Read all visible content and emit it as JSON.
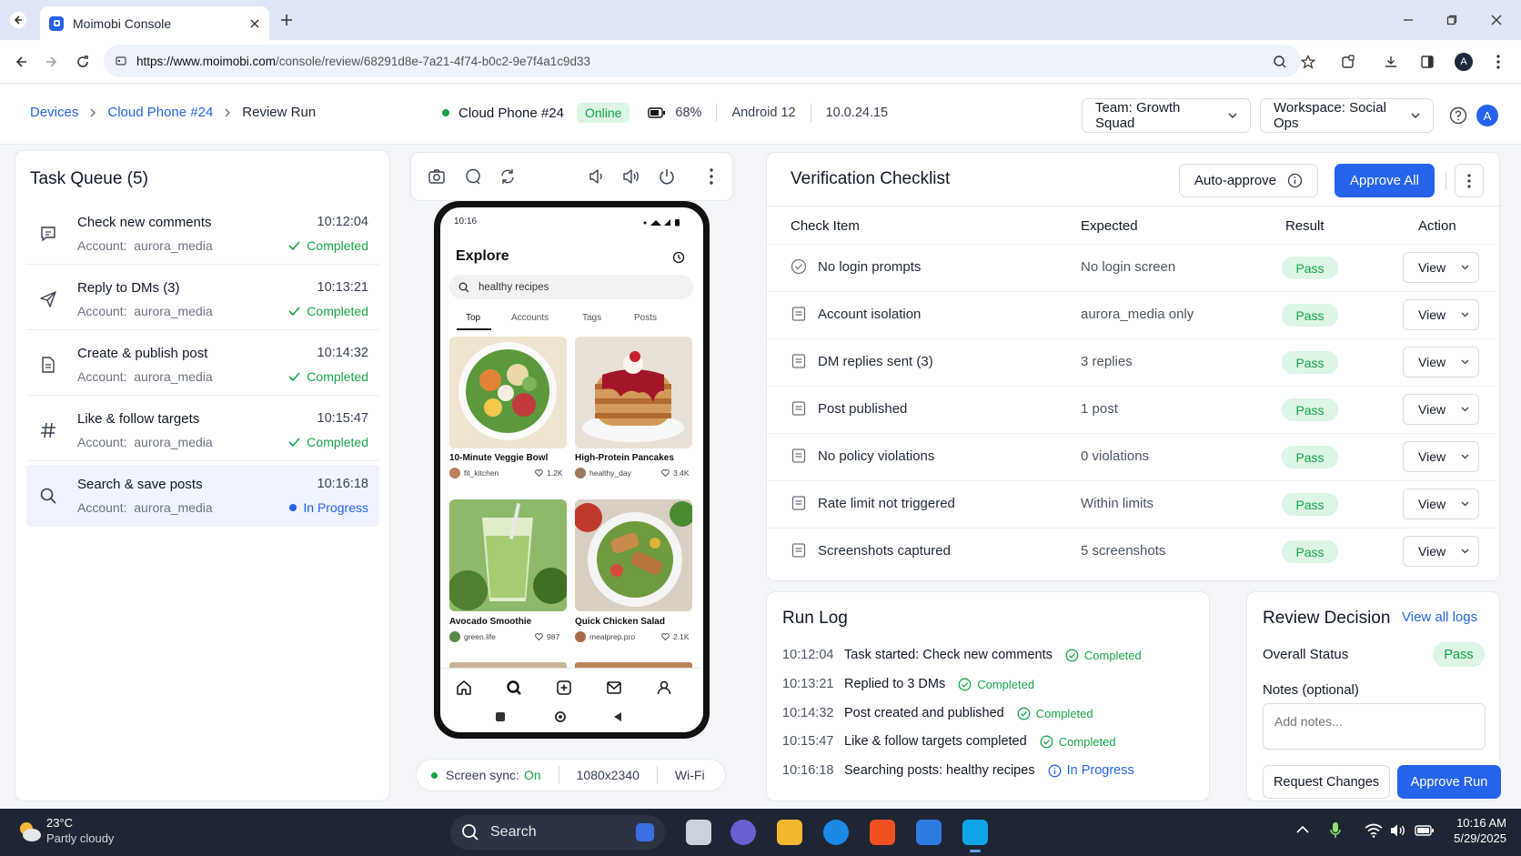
{
  "browser": {
    "tab_title": "Moimobi Console",
    "url_domain": "https://www.moimobi.com",
    "url_path": "/console/review/68291d8e-7a21-4f74-b0c2-9e7f4a1c9d33"
  },
  "header": {
    "breadcrumb": [
      "Devices",
      "Cloud Phone #24",
      "Review Run"
    ],
    "device_name": "Cloud Phone #24",
    "device_status": "Online",
    "battery": "68%",
    "os": "Android 12",
    "ip": "10.0.24.15",
    "team_select": "Team: Growth Squad",
    "workspace_select": "Workspace: Social Ops",
    "avatar_letter": "A"
  },
  "task_queue": {
    "title": "Task Queue (5)",
    "account_label": "Account:",
    "tasks": [
      {
        "name": "Check new comments",
        "account": "aurora_media",
        "time": "10:12:04",
        "status": "Completed",
        "icon": "comment-icon"
      },
      {
        "name": "Reply to DMs (3)",
        "account": "aurora_media",
        "time": "10:13:21",
        "status": "Completed",
        "icon": "send-icon"
      },
      {
        "name": "Create & publish post",
        "account": "aurora_media",
        "time": "10:14:32",
        "status": "Completed",
        "icon": "document-icon"
      },
      {
        "name": "Like & follow targets",
        "account": "aurora_media",
        "time": "10:15:47",
        "status": "Completed",
        "icon": "hashtag-icon"
      },
      {
        "name": "Search & save posts",
        "account": "aurora_media",
        "time": "10:16:18",
        "status": "In Progress",
        "icon": "search-icon"
      }
    ]
  },
  "phone": {
    "clock": "10:16",
    "page_title": "Explore",
    "search_value": "healthy recipes",
    "tabs": [
      "Top",
      "Accounts",
      "Tags",
      "Posts"
    ],
    "posts": [
      {
        "title": "10-Minute Veggie Bowl",
        "user": "fit_kitchen",
        "likes": "1.2K"
      },
      {
        "title": "High-Protein Pancakes",
        "user": "healthy_day",
        "likes": "3.4K"
      },
      {
        "title": "Avocado Smoothie",
        "user": "green.life",
        "likes": "987"
      },
      {
        "title": "Quick Chicken Salad",
        "user": "mealprep.pro",
        "likes": "2.1K"
      }
    ],
    "footer_sync_label": "Screen sync:",
    "footer_sync_value": "On",
    "footer_resolution": "1080x2340",
    "footer_network": "Wi-Fi"
  },
  "checklist": {
    "title": "Verification Checklist",
    "auto_approve_label": "Auto-approve",
    "approve_all_label": "Approve All",
    "columns": [
      "Check Item",
      "Expected",
      "Result",
      "Action"
    ],
    "rows": [
      {
        "item": "No login prompts",
        "expected": "No login screen",
        "result": "Pass",
        "action": "View"
      },
      {
        "item": "Account isolation",
        "expected": "aurora_media only",
        "result": "Pass",
        "action": "View"
      },
      {
        "item": "DM replies sent (3)",
        "expected": "3 replies",
        "result": "Pass",
        "action": "View"
      },
      {
        "item": "Post published",
        "expected": "1 post",
        "result": "Pass",
        "action": "View"
      },
      {
        "item": "No policy violations",
        "expected": "0 violations",
        "result": "Pass",
        "action": "View"
      },
      {
        "item": "Rate limit not triggered",
        "expected": "Within limits",
        "result": "Pass",
        "action": "View"
      },
      {
        "item": "Screenshots captured",
        "expected": "5 screenshots",
        "result": "Pass",
        "action": "View"
      }
    ]
  },
  "run_log": {
    "title": "Run Log",
    "entries": [
      {
        "time": "10:12:04",
        "text": "Task started: Check new comments",
        "status": "Completed"
      },
      {
        "time": "10:13:21",
        "text": "Replied to 3 DMs",
        "status": "Completed"
      },
      {
        "time": "10:14:32",
        "text": "Post created and published",
        "status": "Completed"
      },
      {
        "time": "10:15:47",
        "text": "Like & follow targets completed",
        "status": "Completed"
      },
      {
        "time": "10:16:18",
        "text": "Searching posts: healthy recipes",
        "status": "In Progress"
      }
    ]
  },
  "review": {
    "title": "Review Decision",
    "view_all_logs": "View all logs",
    "overall_status_label": "Overall Status",
    "overall_status_value": "Pass",
    "notes_label": "Notes (optional)",
    "notes_placeholder": "Add notes...",
    "request_changes_label": "Request Changes",
    "approve_run_label": "Approve Run"
  },
  "taskbar": {
    "temperature": "23°C",
    "weather": "Partly cloudy",
    "search_placeholder": "Search",
    "time": "10:16 AM",
    "date": "5/29/2025"
  },
  "colors": {
    "accent": "#2563eb",
    "success": "#16a34a",
    "success_bg": "#dcf5e4"
  }
}
